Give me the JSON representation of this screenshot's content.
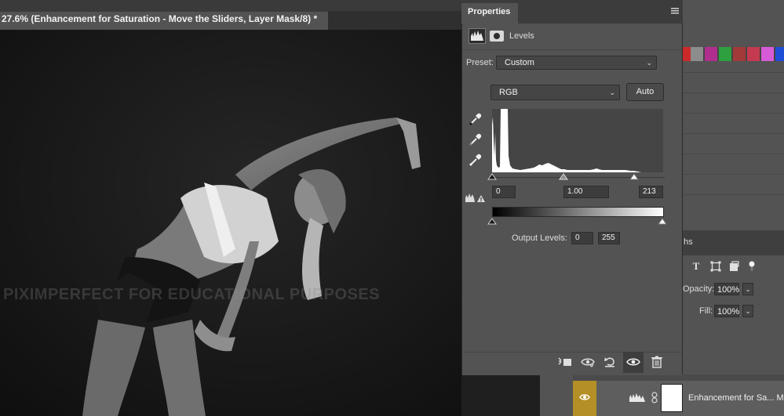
{
  "document": {
    "tab_title": "27.6% (Enhancement for Saturation - Move the Sliders, Layer Mask/8) *",
    "watermark": "PIXIMPERFECT FOR EDUCATIONAL PURPOSES"
  },
  "properties_panel": {
    "title": "Properties",
    "adjustment_title": "Levels",
    "preset_label": "Preset:",
    "preset_value": "Custom",
    "channel_value": "RGB",
    "auto_label": "Auto",
    "input_black": "0",
    "input_gamma": "1.00",
    "input_white": "213",
    "output_label": "Output Levels:",
    "output_black": "0",
    "output_white": "255"
  },
  "layers_panel": {
    "tab_partial": "hs",
    "opacity_label": "Opacity:",
    "opacity_value": "100%",
    "fill_label": "Fill:",
    "fill_value": "100%",
    "layer_name": "Enhancement for Sa... Mo"
  },
  "colors": {
    "accent_eye": "#b38f25",
    "swatches": [
      "#7a1f2a",
      "#cc2a2a",
      "#8c8c8c",
      "#b02f8e",
      "#2fa040",
      "#a33a3a",
      "#c43a4f",
      "#d65bd6",
      "#1f4ed6"
    ]
  },
  "icons": {
    "pickers": [
      "black-point-eyedropper-icon",
      "gray-point-eyedropper-icon",
      "white-point-eyedropper-icon"
    ],
    "footer": [
      "clip-to-layer-icon",
      "view-previous-state-icon",
      "reset-icon",
      "visibility-eye-icon",
      "trash-icon"
    ]
  }
}
